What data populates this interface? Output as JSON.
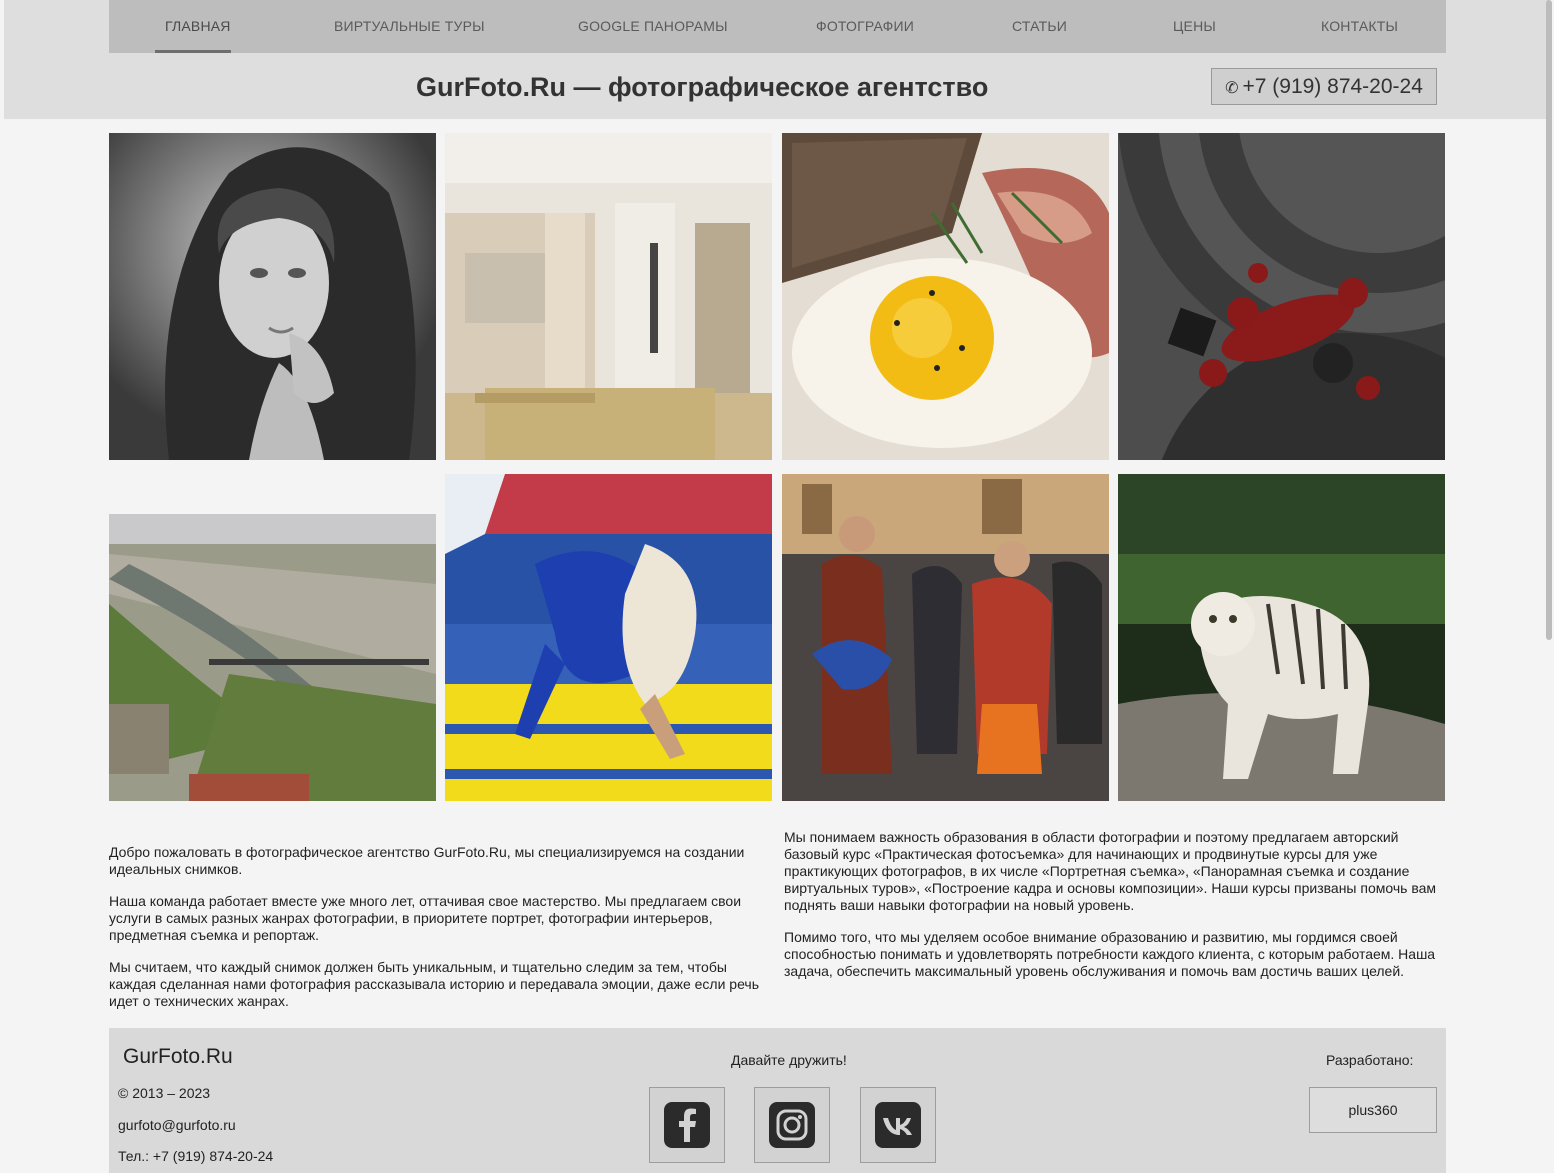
{
  "nav": {
    "items": [
      {
        "label": "ГЛАВНАЯ"
      },
      {
        "label": "ВИРТУАЛЬНЫЕ ТУРЫ"
      },
      {
        "label": "GOOGLE ПАНОРАМЫ"
      },
      {
        "label": "ФОТОГРАФИИ"
      },
      {
        "label": "СТАТЬИ"
      },
      {
        "label": "ЦЕНЫ"
      },
      {
        "label": "КОНТАКТЫ"
      }
    ],
    "active_index": 0
  },
  "header": {
    "title": "GurFoto.Ru — фотографическое агентство",
    "phone": "+7 (919) 874-20-24",
    "phone_icon": "phone-icon"
  },
  "gallery": [
    {
      "subject": "portrait-bw"
    },
    {
      "subject": "interior"
    },
    {
      "subject": "food-egg"
    },
    {
      "subject": "jewelry-vinyl"
    },
    {
      "subject": "paris-river"
    },
    {
      "subject": "judo"
    },
    {
      "subject": "street-procession"
    },
    {
      "subject": "white-tiger"
    }
  ],
  "intro": {
    "left": [
      "Добро пожаловать в фотографическое агентство GurFoto.Ru, мы специализируемся на создании идеальных снимков.",
      "Наша команда работает вместе уже много лет, оттачивая свое мастерство. Мы предлагаем свои услуги в самых разных жанрах фотографии, в приоритете портрет, фотографии интерьеров, предметная съемка и репортаж.",
      "Мы считаем, что каждый снимок должен быть уникальным, и тщательно следим за тем, чтобы каждая сделанная нами фотография рассказывала историю и передавала эмоции, даже если речь идет о технических жанрах."
    ],
    "right": [
      "Мы понимаем важность образования в области фотографии и поэтому предлагаем авторский базовый курс «Практическая фотосъемка» для начинающих и продвинутые курсы для уже практикующих фотографов, в их числе «Портретная съемка», «Панорамная съемка и создание виртуальных туров», «Построение кадра и основы композиции». Наши курсы призваны помочь вам поднять ваши навыки фотографии на новый уровень.",
      "Помимо того, что мы уделяем особое внимание образованию и развитию, мы гордимся своей способностью понимать и удовлетворять потребности каждого клиента, с которым работаем. Наша задача, обеспечить максимальный уровень обслуживания и помочь вам достичь ваших целей."
    ]
  },
  "footer": {
    "site": "GurFoto.Ru",
    "copyright": "© 2013 – 2023",
    "email": "gurfoto@gurfoto.ru",
    "phone": "Тел.: +7 (919) 874-20-24",
    "friends_label": "Давайте дружить!",
    "social": [
      {
        "icon": "facebook-icon"
      },
      {
        "icon": "instagram-icon"
      },
      {
        "icon": "vk-icon"
      }
    ],
    "developed_label": "Разработано:",
    "developer": "plus360"
  },
  "colors": {
    "header_bg": "#dedede",
    "nav_bg": "#bdbdbd",
    "page_bg": "#f4f4f4",
    "footer_bg": "#d9d9d9"
  }
}
